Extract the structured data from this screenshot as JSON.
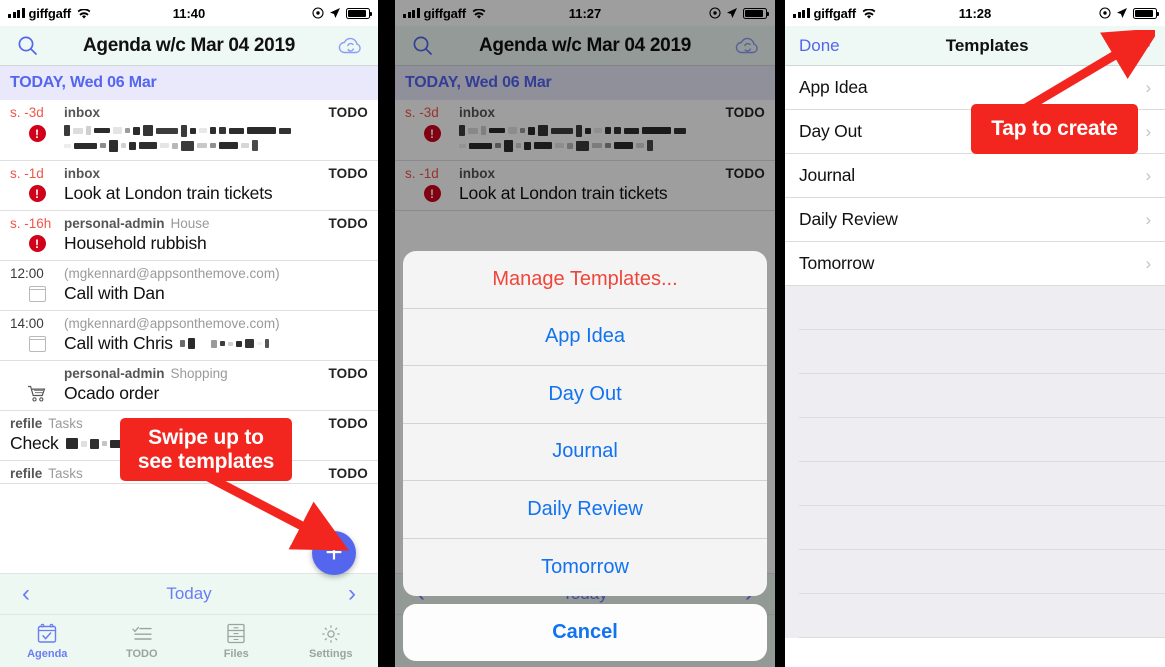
{
  "colors": {
    "accent_blue": "#5465f0",
    "sheet_blue": "#1273f0",
    "annotation_red": "#f3261f",
    "destructive_red": "#f0453a",
    "overdue_red": "#f0564b",
    "badge_red": "#d0021b",
    "nav_bg": "#eef8f4",
    "section_bg": "#e9e9fb",
    "tabbar_bg": "#edf8f2",
    "filler_bg": "#eeeef2"
  },
  "panel1": {
    "status": {
      "carrier": "giffgaff",
      "time": "11:40",
      "wifi_icon": "wifi-icon",
      "signal_icon": "signal-bars-icon",
      "location_icon": "location-arrow-icon",
      "alarm_icon": "alarm-icon",
      "battery_icon": "battery-icon"
    },
    "nav": {
      "search_icon": "search-icon",
      "title": "Agenda w/c Mar 04 2019",
      "sync_icon": "cloud-sync-icon"
    },
    "section_header": "TODAY, Wed 06 Mar",
    "rows": [
      {
        "when": "s. -3d",
        "context": "inbox",
        "context2": "",
        "badge": "TODO",
        "icon": "alert-icon",
        "text": "",
        "redacted": true
      },
      {
        "when": "s. -1d",
        "context": "inbox",
        "context2": "",
        "badge": "TODO",
        "icon": "alert-icon",
        "text": "Look at London train tickets",
        "redacted": false
      },
      {
        "when": "s. -16h",
        "context": "personal-admin",
        "context2": "House",
        "badge": "TODO",
        "icon": "alert-icon",
        "text": "Household rubbish",
        "redacted": false
      },
      {
        "when": "12:00",
        "context": "(mgkennard@appsonthemove.com)",
        "context2": "",
        "badge": "",
        "icon": "calendar-icon",
        "text": "Call with Dan",
        "redacted": false
      },
      {
        "when": "14:00",
        "context": "(mgkennard@appsonthemove.com)",
        "context2": "",
        "badge": "",
        "icon": "calendar-icon",
        "text": "Call with Chris",
        "redacted": "partial"
      },
      {
        "when": "",
        "context": "personal-admin",
        "context2": "Shopping",
        "badge": "TODO",
        "icon": "cart-icon",
        "text": "Ocado order",
        "redacted": false
      },
      {
        "when": "",
        "context": "refile",
        "context2": "Tasks",
        "badge": "TODO",
        "icon": "",
        "text": "Check",
        "redacted": "partial"
      },
      {
        "when": "",
        "context": "refile",
        "context2": "Tasks",
        "badge": "TODO",
        "icon": "",
        "text": "",
        "redacted": false
      }
    ],
    "today_bar": {
      "prev_icon": "chevron-left-icon",
      "label": "Today",
      "next_icon": "chevron-right-icon"
    },
    "fab": {
      "label": "+",
      "chevron": "chevron-up-icon"
    },
    "tabs": [
      {
        "label": "Agenda",
        "icon": "calendar-check-icon",
        "active": true
      },
      {
        "label": "TODO",
        "icon": "checklist-icon",
        "active": false
      },
      {
        "label": "Files",
        "icon": "drawers-icon",
        "active": false
      },
      {
        "label": "Settings",
        "icon": "gear-icon",
        "active": false
      }
    ],
    "annotation": {
      "line1": "Swipe up to",
      "line2": "see templates"
    }
  },
  "panel2": {
    "status": {
      "carrier": "giffgaff",
      "time": "11:27"
    },
    "nav": {
      "search_icon": "search-icon",
      "title": "Agenda w/c Mar 04 2019",
      "sync_icon": "cloud-sync-icon"
    },
    "section_header": "TODAY, Wed 06 Mar",
    "rows": [
      {
        "when": "s. -3d",
        "context": "inbox",
        "badge": "TODO",
        "icon": "alert-icon",
        "text": "",
        "redacted": true
      },
      {
        "when": "s. -1d",
        "context": "inbox",
        "badge": "TODO",
        "icon": "alert-icon",
        "text": "Look at London train tickets",
        "redacted": false
      }
    ],
    "today_bar": {
      "label": "Today"
    },
    "action_sheet": {
      "items": [
        {
          "label": "Manage Templates...",
          "style": "destructive"
        },
        {
          "label": "App Idea",
          "style": "default"
        },
        {
          "label": "Day Out",
          "style": "default"
        },
        {
          "label": "Journal",
          "style": "default"
        },
        {
          "label": "Daily Review",
          "style": "default"
        },
        {
          "label": "Tomorrow",
          "style": "default"
        }
      ],
      "cancel_label": "Cancel"
    }
  },
  "panel3": {
    "status": {
      "carrier": "giffgaff",
      "time": "11:28"
    },
    "nav": {
      "done_label": "Done",
      "title": "Templates",
      "add_icon": "plus-icon"
    },
    "templates": [
      {
        "label": "App Idea",
        "disclosure": "chevron-right-icon"
      },
      {
        "label": "Day Out",
        "disclosure": "chevron-right-icon"
      },
      {
        "label": "Journal",
        "disclosure": "chevron-right-icon"
      },
      {
        "label": "Daily Review",
        "disclosure": "chevron-right-icon"
      },
      {
        "label": "Tomorrow",
        "disclosure": "chevron-right-icon"
      }
    ],
    "annotation": {
      "text": "Tap to create"
    }
  }
}
